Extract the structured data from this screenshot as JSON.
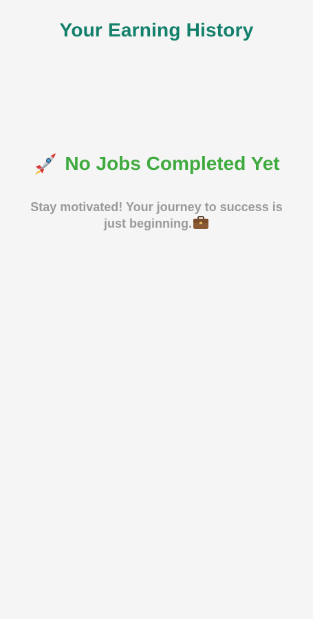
{
  "header": {
    "title": "Your Earning History"
  },
  "empty_state": {
    "icon": "rocket-icon",
    "title": "No Jobs Completed Yet",
    "message": "Stay motivated! Your journey to success is just beginning.",
    "trailing_icon": "briefcase-icon"
  },
  "colors": {
    "background": "#f5f5f5",
    "title": "#13806b",
    "empty_title": "#3faa3e",
    "message": "#9a9a9a"
  }
}
